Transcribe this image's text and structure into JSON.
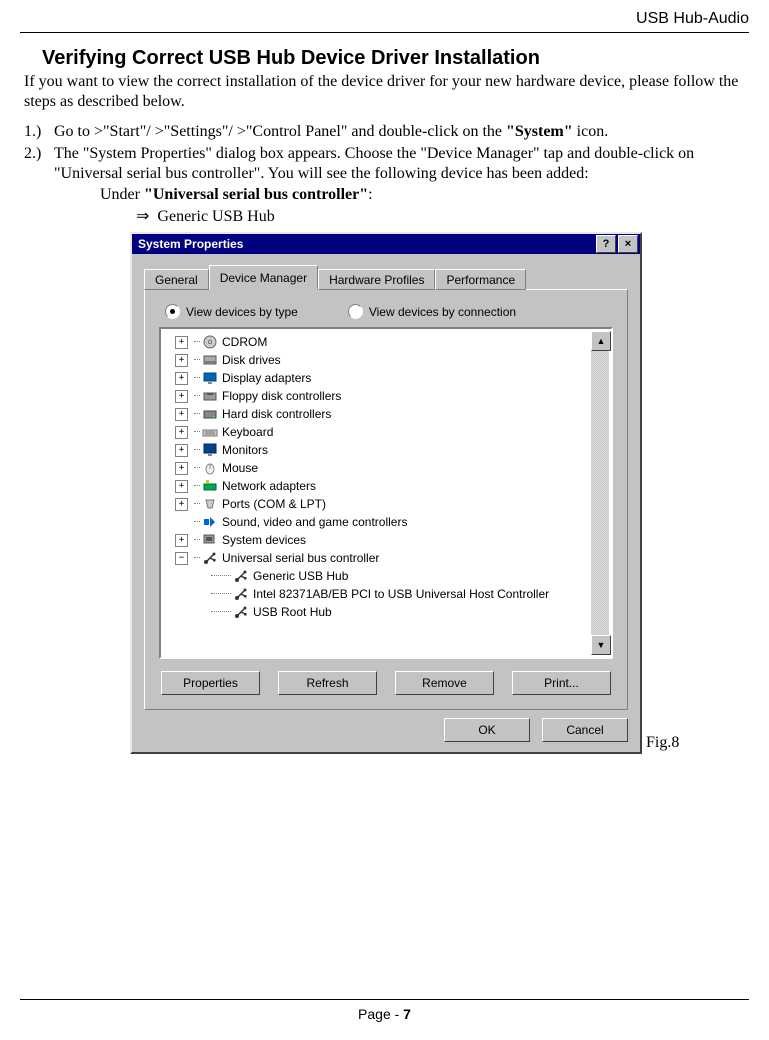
{
  "header_right": "USB Hub-Audio",
  "section_title": "Verifying Correct USB Hub Device Driver Installation",
  "intro": "If you want to view the correct installation of the device driver for your new hardware device, please follow the steps as described below.",
  "step1_num": "1.)",
  "step1_a": "Go to >\"Start\"/ >\"Settings\"/ >\"Control Panel\" and double-click on the ",
  "step1_b": "\"System\"",
  "step1_c": " icon.",
  "step2_num": "2.)",
  "step2_text": "The \"System Properties\" dialog box appears. Choose the \"Device Manager\" tap and double-click on \"Universal serial bus controller\". You will see the following device has been added:",
  "under_a": "Under ",
  "under_b": "\"Universal serial bus controller\"",
  "under_c": ":",
  "arrow": "⇒",
  "arrow_text": "Generic USB Hub",
  "fig_label": "Fig.8",
  "page_label_a": "Page - ",
  "page_label_b": "7",
  "dialog": {
    "title": "System Properties",
    "help_btn": "?",
    "close_btn": "×",
    "tabs": [
      "General",
      "Device Manager",
      "Hardware Profiles",
      "Performance"
    ],
    "radio1": "View devices by type",
    "radio2": "View devices by connection",
    "tree": [
      {
        "exp": "+",
        "label": "CDROM",
        "icon": "cdrom"
      },
      {
        "exp": "+",
        "label": "Disk drives",
        "icon": "disk"
      },
      {
        "exp": "+",
        "label": "Display adapters",
        "icon": "display"
      },
      {
        "exp": "+",
        "label": "Floppy disk controllers",
        "icon": "floppy"
      },
      {
        "exp": "+",
        "label": "Hard disk controllers",
        "icon": "hdd"
      },
      {
        "exp": "+",
        "label": "Keyboard",
        "icon": "keyboard"
      },
      {
        "exp": "+",
        "label": "Monitors",
        "icon": "monitor"
      },
      {
        "exp": "+",
        "label": "Mouse",
        "icon": "mouse"
      },
      {
        "exp": "+",
        "label": "Network adapters",
        "icon": "network"
      },
      {
        "exp": "+",
        "label": "Ports (COM & LPT)",
        "icon": "ports"
      },
      {
        "exp": "",
        "label": "Sound, video and game controllers",
        "icon": "sound"
      },
      {
        "exp": "+",
        "label": "System devices",
        "icon": "system"
      },
      {
        "exp": "−",
        "label": "Universal serial bus controller",
        "icon": "usb"
      }
    ],
    "usb_children": [
      "Generic USB Hub",
      "Intel 82371AB/EB PCI to USB Universal Host Controller",
      "USB Root Hub"
    ],
    "buttons": [
      "Properties",
      "Refresh",
      "Remove",
      "Print..."
    ],
    "ok": "OK",
    "cancel": "Cancel"
  }
}
